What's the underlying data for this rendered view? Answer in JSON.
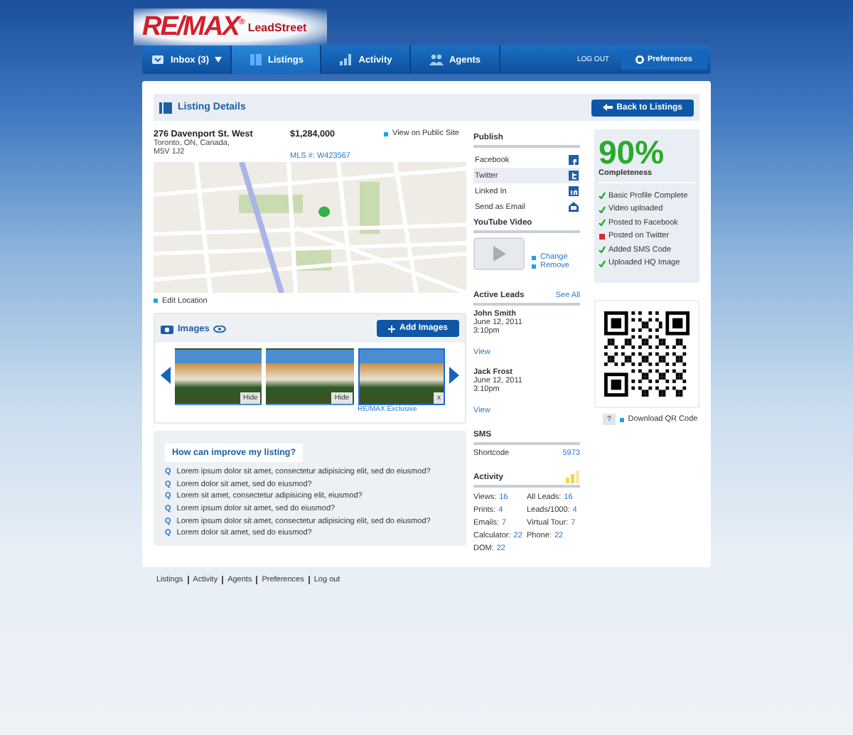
{
  "brand": {
    "logo": "RE/MAX$^{®}$",
    "sub": "LeadStreet"
  },
  "nav": {
    "tabs": [
      {
        "label": "Inbox (3)",
        "dropdown": true,
        "selected": false
      },
      {
        "label": "Listings",
        "dropdown": false,
        "selected": true
      },
      {
        "label": "Activity",
        "dropdown": false,
        "selected": false
      },
      {
        "label": "Agents",
        "dropdown": false,
        "selected": false
      }
    ],
    "logout": "LOG OUT",
    "preferences": "Preferences"
  },
  "header": {
    "title": "Listing Details",
    "back": "Back to Listings"
  },
  "listing": {
    "address": "276 Davenport St. West",
    "city": "Toronto, ON, Canada,",
    "postal": "M5V 1J2",
    "price": "$1,284,000",
    "mls": "MLS #: W423567",
    "public_link": "View on Public Site",
    "edit_location": "Edit Location"
  },
  "images": {
    "title": "Images",
    "add": "Add Images",
    "photos": [
      {
        "overlay": "Hide",
        "selected": false
      },
      {
        "overlay": "Hide",
        "selected": false
      },
      {
        "overlay": "x",
        "selected": true,
        "caption": "RE/MAX Exclusive"
      }
    ]
  },
  "improve": {
    "title": "How can improve my listing?",
    "questions": [
      {
        "marker": "Q",
        "text": "Lorem ipsum dolor sit amet, consectetur adipisicing elit, sed do eiusmod?"
      },
      {
        "marker": "Q",
        "text": "Lorem dolor sit amet, sed do eiusmod?"
      },
      {
        "marker": "Q",
        "text": "Lorem sit amet, consectetur adipisicing elit, eiusmod?"
      },
      {
        "marker": "Q",
        "text": "Lorem ipsum dolor sit amet, sed do eiusmod?"
      },
      {
        "marker": "Q",
        "text": "Lorem ipsum dolor sit amet, consectetur adipisicing elit, sed do eiusmod?"
      },
      {
        "marker": "Q",
        "text": "Lorem dolor sit amet, sed do eiusmod?"
      }
    ]
  },
  "publish": {
    "title": "Publish",
    "items": [
      {
        "label": "Facebook",
        "selected": false
      },
      {
        "label": "Twitter",
        "selected": true
      },
      {
        "label": "Linked In",
        "selected": false
      },
      {
        "label": "Send as Email",
        "selected": false
      }
    ]
  },
  "video": {
    "title": "YouTube Video",
    "links": [
      "Change",
      "Remove"
    ]
  },
  "leads": {
    "title": "Active Leads",
    "see_all": "See All",
    "items": [
      {
        "name": "John Smith",
        "date": "June 12, 2011",
        "time": "3:10pm",
        "link": "View"
      },
      {
        "name": "Jack Frost",
        "date": "June 12, 2011",
        "time": "3:10pm",
        "link": "View"
      }
    ]
  },
  "sms": {
    "title": "SMS",
    "label": "Shortcode",
    "value": "5973"
  },
  "activity": {
    "title": "Activity",
    "stats": [
      {
        "label": "Views:",
        "value": "16"
      },
      {
        "label": "All Leads:",
        "value": "16"
      },
      {
        "label": "Prints:",
        "value": "4"
      },
      {
        "label": "Leads/1000:",
        "value": "4"
      },
      {
        "label": "Emails:",
        "value": "7"
      },
      {
        "label": "Virtual Tour:",
        "value": "7"
      },
      {
        "label": "Calculator:",
        "value": "22"
      },
      {
        "label": "Phone:",
        "value": "22"
      },
      {
        "label": "DOM:",
        "value": "22"
      }
    ]
  },
  "completeness": {
    "percent": "90%",
    "label": "Completeness",
    "items": [
      {
        "label": "Basic Profile Complete",
        "done": true
      },
      {
        "label": "Video uploaded",
        "done": true
      },
      {
        "label": "Posted to Facebook",
        "done": true
      },
      {
        "label": "Posted on Twitter",
        "done": false
      },
      {
        "label": "Added SMS Code",
        "done": true
      },
      {
        "label": "Uploaded HQ Image",
        "done": true
      }
    ]
  },
  "qr": {
    "help": "?",
    "download": "Download QR Code"
  },
  "footer": [
    "Listings",
    "Activity",
    "Agents",
    "Preferences",
    "Log out"
  ]
}
